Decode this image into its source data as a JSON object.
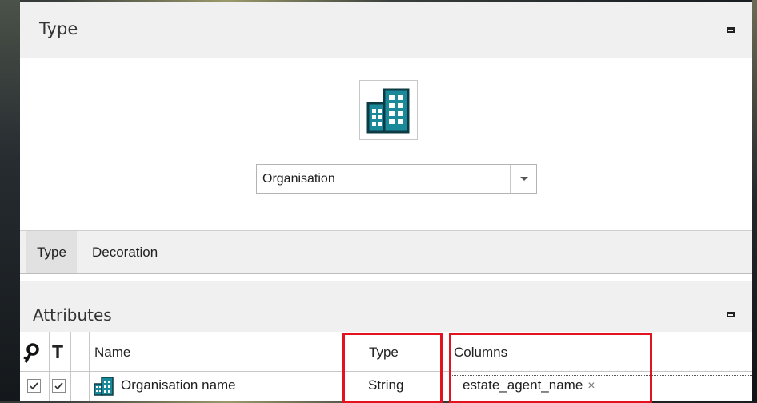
{
  "type_panel": {
    "title": "Type",
    "selected_type": "Organisation",
    "icon": "building-icon"
  },
  "tabs": [
    {
      "label": "Type",
      "active": true
    },
    {
      "label": "Decoration",
      "active": false
    }
  ],
  "attributes_panel": {
    "title": "Attributes",
    "columns": {
      "key_icon": "key-icon",
      "text_icon_label": "T",
      "name": "Name",
      "type": "Type",
      "columns": "Columns"
    },
    "rows": [
      {
        "key_checked": true,
        "text_checked": true,
        "icon": "building-icon",
        "name": "Organisation name",
        "type": "String",
        "column_tag": "estate_agent_name",
        "column_tag_remove": "×"
      }
    ]
  },
  "colors": {
    "highlight": "#e0131f",
    "icon_teal": "#1a8a9a"
  }
}
